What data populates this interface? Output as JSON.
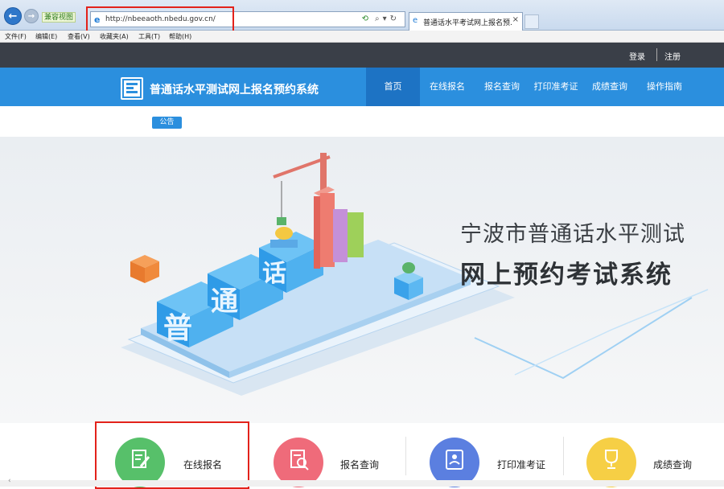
{
  "browser": {
    "compat_label": "兼容视图",
    "url": "http://nbeeaoth.nbedu.gov.cn/",
    "tab_title": "普通话水平考试网上报名预...",
    "tab_close": "×",
    "menu": [
      "文件(F)",
      "编辑(E)",
      "查看(V)",
      "收藏夹(A)",
      "工具(T)",
      "帮助(H)"
    ]
  },
  "topbar": {
    "login": "登录",
    "register": "注册"
  },
  "site": {
    "title": "普通话水平测试网上报名预约系统",
    "nav": [
      "首页",
      "在线报名",
      "报名查询",
      "打印准考证",
      "成绩查询",
      "操作指南"
    ],
    "active_nav": "首页",
    "notice_label": "公告"
  },
  "banner": {
    "line1": "宁波市普通话水平测试",
    "line2": "网上预约考试系统",
    "art_text": [
      "普",
      "通",
      "话"
    ]
  },
  "services": [
    {
      "label": "在线报名",
      "icon": "form-edit-icon",
      "color": "#57c06a"
    },
    {
      "label": "报名查询",
      "icon": "document-search-icon",
      "color": "#ef6b7a"
    },
    {
      "label": "打印准考证",
      "icon": "id-card-icon",
      "color": "#5b7fe0"
    },
    {
      "label": "成绩查询",
      "icon": "trophy-icon",
      "color": "#f6cf45"
    }
  ],
  "colors": {
    "nav_blue": "#2b8fde",
    "nav_active": "#1d73c4",
    "topbar": "#3a3f48",
    "highlight_red": "#e3221b"
  }
}
